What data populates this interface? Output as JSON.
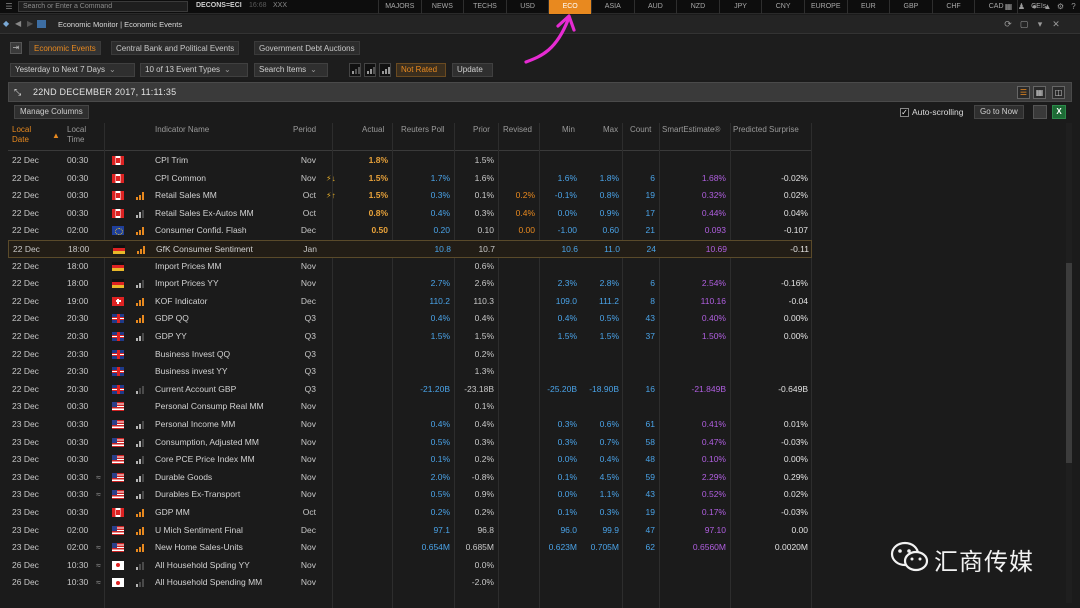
{
  "topbar": {
    "command_placeholder": "Search or Enter a Command",
    "code": "DECONS=ECI",
    "time": "16:68",
    "suffix": "XXX",
    "market_tabs": [
      "MAJORS",
      "NEWS",
      "TECHS",
      "USD",
      "ECO",
      "ASIA",
      "AUD",
      "NZD",
      "JPY",
      "CNY",
      "EUROPE",
      "EUR",
      "GBP",
      "CHF",
      "CAD",
      "CEIs"
    ],
    "active_tab": "ECO",
    "icons": [
      "grid-icon",
      "user-icon",
      "chat-icon",
      "bell-icon",
      "settings-icon",
      "help-icon"
    ]
  },
  "window": {
    "title": "Economic Monitor | Economic Events"
  },
  "subtabs": [
    "Economic Events",
    "Central Bank and Political Events",
    "Government Debt Auctions"
  ],
  "filters": {
    "date_range": "Yesterday to Next 7 Days",
    "event_types": "10 of 13 Event Types",
    "search": "Search Items",
    "rating_label": "Not Rated",
    "update_label": "Update"
  },
  "datebar": {
    "datetime": "22ND DECEMBER 2017, 11:11:35"
  },
  "toolbar": {
    "manage_columns": "Manage Columns",
    "autoscroll": "Auto-scrolling",
    "go_to_now": "Go to Now"
  },
  "columns": {
    "local_date": "Local Date",
    "local_time": "Local Time",
    "indicator": "Indicator Name",
    "period": "Period",
    "actual": "Actual",
    "poll": "Reuters Poll",
    "prior": "Prior",
    "revised": "Revised",
    "min": "Min",
    "max": "Max",
    "count": "Count",
    "smart": "SmartEstimate®",
    "surprise": "Predicted Surprise"
  },
  "rows": [
    {
      "date": "22 Dec",
      "time": "00:30",
      "tilde": "",
      "flag": "CA",
      "bars": 0,
      "name": "CPI Trim",
      "period": "Nov",
      "alert": "",
      "actual": "1.8%",
      "poll": "",
      "prior": "1.5%",
      "revised": "",
      "min": "",
      "max": "",
      "count": "",
      "smart": "",
      "surprise": ""
    },
    {
      "date": "22 Dec",
      "time": "00:30",
      "tilde": "",
      "flag": "CA",
      "bars": 0,
      "name": "CPI Common",
      "period": "Nov",
      "alert": "⚡↓",
      "actual": "1.5%",
      "poll": "1.7%",
      "prior": "1.6%",
      "revised": "",
      "min": "1.6%",
      "max": "1.8%",
      "count": "6",
      "smart": "1.68%",
      "surprise": "-0.02%"
    },
    {
      "date": "22 Dec",
      "time": "00:30",
      "tilde": "",
      "flag": "CA",
      "bars": 3,
      "name": "Retail Sales MM",
      "period": "Oct",
      "alert": "⚡↑",
      "actual": "1.5%",
      "poll": "0.3%",
      "prior": "0.1%",
      "revised": "0.2%",
      "min": "-0.1%",
      "max": "0.8%",
      "count": "19",
      "smart": "0.32%",
      "surprise": "0.02%"
    },
    {
      "date": "22 Dec",
      "time": "00:30",
      "tilde": "",
      "flag": "CA",
      "bars": 2,
      "name": "Retail Sales Ex-Autos MM",
      "period": "Oct",
      "alert": "",
      "actual": "0.8%",
      "poll": "0.4%",
      "prior": "0.3%",
      "revised": "0.4%",
      "min": "0.0%",
      "max": "0.9%",
      "count": "17",
      "smart": "0.44%",
      "surprise": "0.04%"
    },
    {
      "date": "22 Dec",
      "time": "02:00",
      "tilde": "",
      "flag": "EU",
      "bars": 3,
      "name": "Consumer Confid. Flash",
      "period": "Dec",
      "alert": "",
      "actual": "0.50",
      "poll": "0.20",
      "prior": "0.10",
      "revised": "0.00",
      "min": "-1.00",
      "max": "0.60",
      "count": "21",
      "smart": "0.093",
      "surprise": "-0.107"
    },
    {
      "date": "22 Dec",
      "time": "18:00",
      "tilde": "",
      "flag": "DE",
      "bars": 3,
      "name": "GfK Consumer Sentiment",
      "period": "Jan",
      "alert": "",
      "actual": "",
      "poll": "10.8",
      "prior": "10.7",
      "revised": "",
      "min": "10.6",
      "max": "11.0",
      "count": "24",
      "smart": "10.69",
      "surprise": "-0.11",
      "highlight": true
    },
    {
      "date": "22 Dec",
      "time": "18:00",
      "tilde": "",
      "flag": "DE",
      "bars": 0,
      "name": "Import Prices MM",
      "period": "Nov",
      "alert": "",
      "actual": "",
      "poll": "",
      "prior": "0.6%",
      "revised": "",
      "min": "",
      "max": "",
      "count": "",
      "smart": "",
      "surprise": ""
    },
    {
      "date": "22 Dec",
      "time": "18:00",
      "tilde": "",
      "flag": "DE",
      "bars": 2,
      "name": "Import Prices YY",
      "period": "Nov",
      "alert": "",
      "actual": "",
      "poll": "2.7%",
      "prior": "2.6%",
      "revised": "",
      "min": "2.3%",
      "max": "2.8%",
      "count": "6",
      "smart": "2.54%",
      "surprise": "-0.16%"
    },
    {
      "date": "22 Dec",
      "time": "19:00",
      "tilde": "",
      "flag": "CH",
      "bars": 3,
      "name": "KOF Indicator",
      "period": "Dec",
      "alert": "",
      "actual": "",
      "poll": "110.2",
      "prior": "110.3",
      "revised": "",
      "min": "109.0",
      "max": "111.2",
      "count": "8",
      "smart": "110.16",
      "surprise": "-0.04"
    },
    {
      "date": "22 Dec",
      "time": "20:30",
      "tilde": "",
      "flag": "GB",
      "bars": 3,
      "name": "GDP QQ",
      "period": "Q3",
      "alert": "",
      "actual": "",
      "poll": "0.4%",
      "prior": "0.4%",
      "revised": "",
      "min": "0.4%",
      "max": "0.5%",
      "count": "43",
      "smart": "0.40%",
      "surprise": "0.00%"
    },
    {
      "date": "22 Dec",
      "time": "20:30",
      "tilde": "",
      "flag": "GB",
      "bars": 2,
      "name": "GDP YY",
      "period": "Q3",
      "alert": "",
      "actual": "",
      "poll": "1.5%",
      "prior": "1.5%",
      "revised": "",
      "min": "1.5%",
      "max": "1.5%",
      "count": "37",
      "smart": "1.50%",
      "surprise": "0.00%"
    },
    {
      "date": "22 Dec",
      "time": "20:30",
      "tilde": "",
      "flag": "GB",
      "bars": 0,
      "name": "Business Invest QQ",
      "period": "Q3",
      "alert": "",
      "actual": "",
      "poll": "",
      "prior": "0.2%",
      "revised": "",
      "min": "",
      "max": "",
      "count": "",
      "smart": "",
      "surprise": ""
    },
    {
      "date": "22 Dec",
      "time": "20:30",
      "tilde": "",
      "flag": "GB",
      "bars": 0,
      "name": "Business invest YY",
      "period": "Q3",
      "alert": "",
      "actual": "",
      "poll": "",
      "prior": "1.3%",
      "revised": "",
      "min": "",
      "max": "",
      "count": "",
      "smart": "",
      "surprise": ""
    },
    {
      "date": "22 Dec",
      "time": "20:30",
      "tilde": "",
      "flag": "GB",
      "bars": 1,
      "name": "Current Account GBP",
      "period": "Q3",
      "alert": "",
      "actual": "",
      "poll": "-21.20B",
      "prior": "-23.18B",
      "revised": "",
      "min": "-25.20B",
      "max": "-18.90B",
      "count": "16",
      "smart": "-21.849B",
      "surprise": "-0.649B"
    },
    {
      "date": "23 Dec",
      "time": "00:30",
      "tilde": "",
      "flag": "US",
      "bars": 0,
      "name": "Personal Consump Real MM",
      "period": "Nov",
      "alert": "",
      "actual": "",
      "poll": "",
      "prior": "0.1%",
      "revised": "",
      "min": "",
      "max": "",
      "count": "",
      "smart": "",
      "surprise": ""
    },
    {
      "date": "23 Dec",
      "time": "00:30",
      "tilde": "",
      "flag": "US",
      "bars": 2,
      "name": "Personal Income MM",
      "period": "Nov",
      "alert": "",
      "actual": "",
      "poll": "0.4%",
      "prior": "0.4%",
      "revised": "",
      "min": "0.3%",
      "max": "0.6%",
      "count": "61",
      "smart": "0.41%",
      "surprise": "0.01%"
    },
    {
      "date": "23 Dec",
      "time": "00:30",
      "tilde": "",
      "flag": "US",
      "bars": 2,
      "name": "Consumption, Adjusted MM",
      "period": "Nov",
      "alert": "",
      "actual": "",
      "poll": "0.5%",
      "prior": "0.3%",
      "revised": "",
      "min": "0.3%",
      "max": "0.7%",
      "count": "58",
      "smart": "0.47%",
      "surprise": "-0.03%"
    },
    {
      "date": "23 Dec",
      "time": "00:30",
      "tilde": "",
      "flag": "US",
      "bars": 2,
      "name": "Core PCE Price Index MM",
      "period": "Nov",
      "alert": "",
      "actual": "",
      "poll": "0.1%",
      "prior": "0.2%",
      "revised": "",
      "min": "0.0%",
      "max": "0.4%",
      "count": "48",
      "smart": "0.10%",
      "surprise": "0.00%"
    },
    {
      "date": "23 Dec",
      "time": "00:30",
      "tilde": "≈",
      "flag": "US",
      "bars": 2,
      "name": "Durable Goods",
      "period": "Nov",
      "alert": "",
      "actual": "",
      "poll": "2.0%",
      "prior": "-0.8%",
      "revised": "",
      "min": "0.1%",
      "max": "4.5%",
      "count": "59",
      "smart": "2.29%",
      "surprise": "0.29%"
    },
    {
      "date": "23 Dec",
      "time": "00:30",
      "tilde": "≈",
      "flag": "US",
      "bars": 2,
      "name": "Durables Ex-Transport",
      "period": "Nov",
      "alert": "",
      "actual": "",
      "poll": "0.5%",
      "prior": "0.9%",
      "revised": "",
      "min": "0.0%",
      "max": "1.1%",
      "count": "43",
      "smart": "0.52%",
      "surprise": "0.02%"
    },
    {
      "date": "23 Dec",
      "time": "00:30",
      "tilde": "",
      "flag": "CA",
      "bars": 3,
      "name": "GDP MM",
      "period": "Oct",
      "alert": "",
      "actual": "",
      "poll": "0.2%",
      "prior": "0.2%",
      "revised": "",
      "min": "0.1%",
      "max": "0.3%",
      "count": "19",
      "smart": "0.17%",
      "surprise": "-0.03%"
    },
    {
      "date": "23 Dec",
      "time": "02:00",
      "tilde": "",
      "flag": "US",
      "bars": 3,
      "name": "U Mich Sentiment Final",
      "period": "Dec",
      "alert": "",
      "actual": "",
      "poll": "97.1",
      "prior": "96.8",
      "revised": "",
      "min": "96.0",
      "max": "99.9",
      "count": "47",
      "smart": "97.10",
      "surprise": "0.00"
    },
    {
      "date": "23 Dec",
      "time": "02:00",
      "tilde": "≈",
      "flag": "US",
      "bars": 3,
      "name": "New Home Sales-Units",
      "period": "Nov",
      "alert": "",
      "actual": "",
      "poll": "0.654M",
      "prior": "0.685M",
      "revised": "",
      "min": "0.623M",
      "max": "0.705M",
      "count": "62",
      "smart": "0.6560M",
      "surprise": "0.0020M"
    },
    {
      "date": "26 Dec",
      "time": "10:30",
      "tilde": "≈",
      "flag": "JP",
      "bars": 1,
      "name": "All Household Spding YY",
      "period": "Nov",
      "alert": "",
      "actual": "",
      "poll": "",
      "prior": "0.0%",
      "revised": "",
      "min": "",
      "max": "",
      "count": "",
      "smart": "",
      "surprise": ""
    },
    {
      "date": "26 Dec",
      "time": "10:30",
      "tilde": "≈",
      "flag": "JP",
      "bars": 1,
      "name": "All Household Spending MM",
      "period": "Nov",
      "alert": "",
      "actual": "",
      "poll": "",
      "prior": "-2.0%",
      "revised": "",
      "min": "",
      "max": "",
      "count": "",
      "smart": "",
      "surprise": ""
    }
  ],
  "watermark": {
    "text": "汇商传媒"
  },
  "colors": {
    "accent": "#e8891f",
    "poll_blue": "#4aa3e8",
    "smart_purple": "#b05fe0",
    "annotation_pink": "#e62bd2"
  }
}
